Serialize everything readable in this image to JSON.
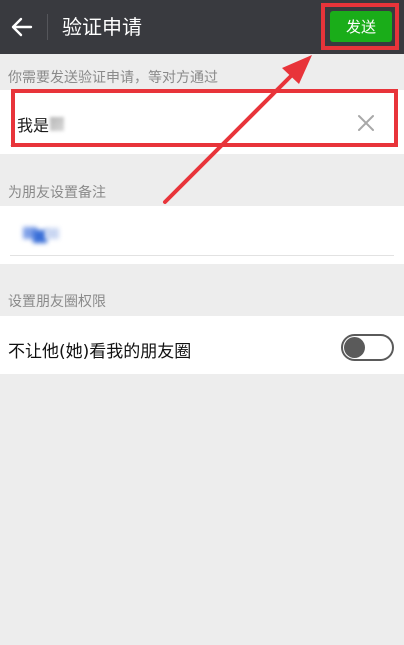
{
  "header": {
    "title": "验证申请",
    "send_label": "发送",
    "back_icon": "arrow-left-icon"
  },
  "request": {
    "label": "你需要发送验证申请，等对方通过",
    "value": "我是",
    "clear_icon": "close-icon"
  },
  "remark": {
    "label": "为朋友设置备注"
  },
  "moments": {
    "label": "设置朋友圈权限",
    "toggle_label": "不让他(她)看我的朋友圈",
    "toggle_on": false
  },
  "colors": {
    "header_bg": "#393a3f",
    "send_green": "#1aad19",
    "annotation_red": "#e8343a",
    "page_bg": "#ededed"
  }
}
